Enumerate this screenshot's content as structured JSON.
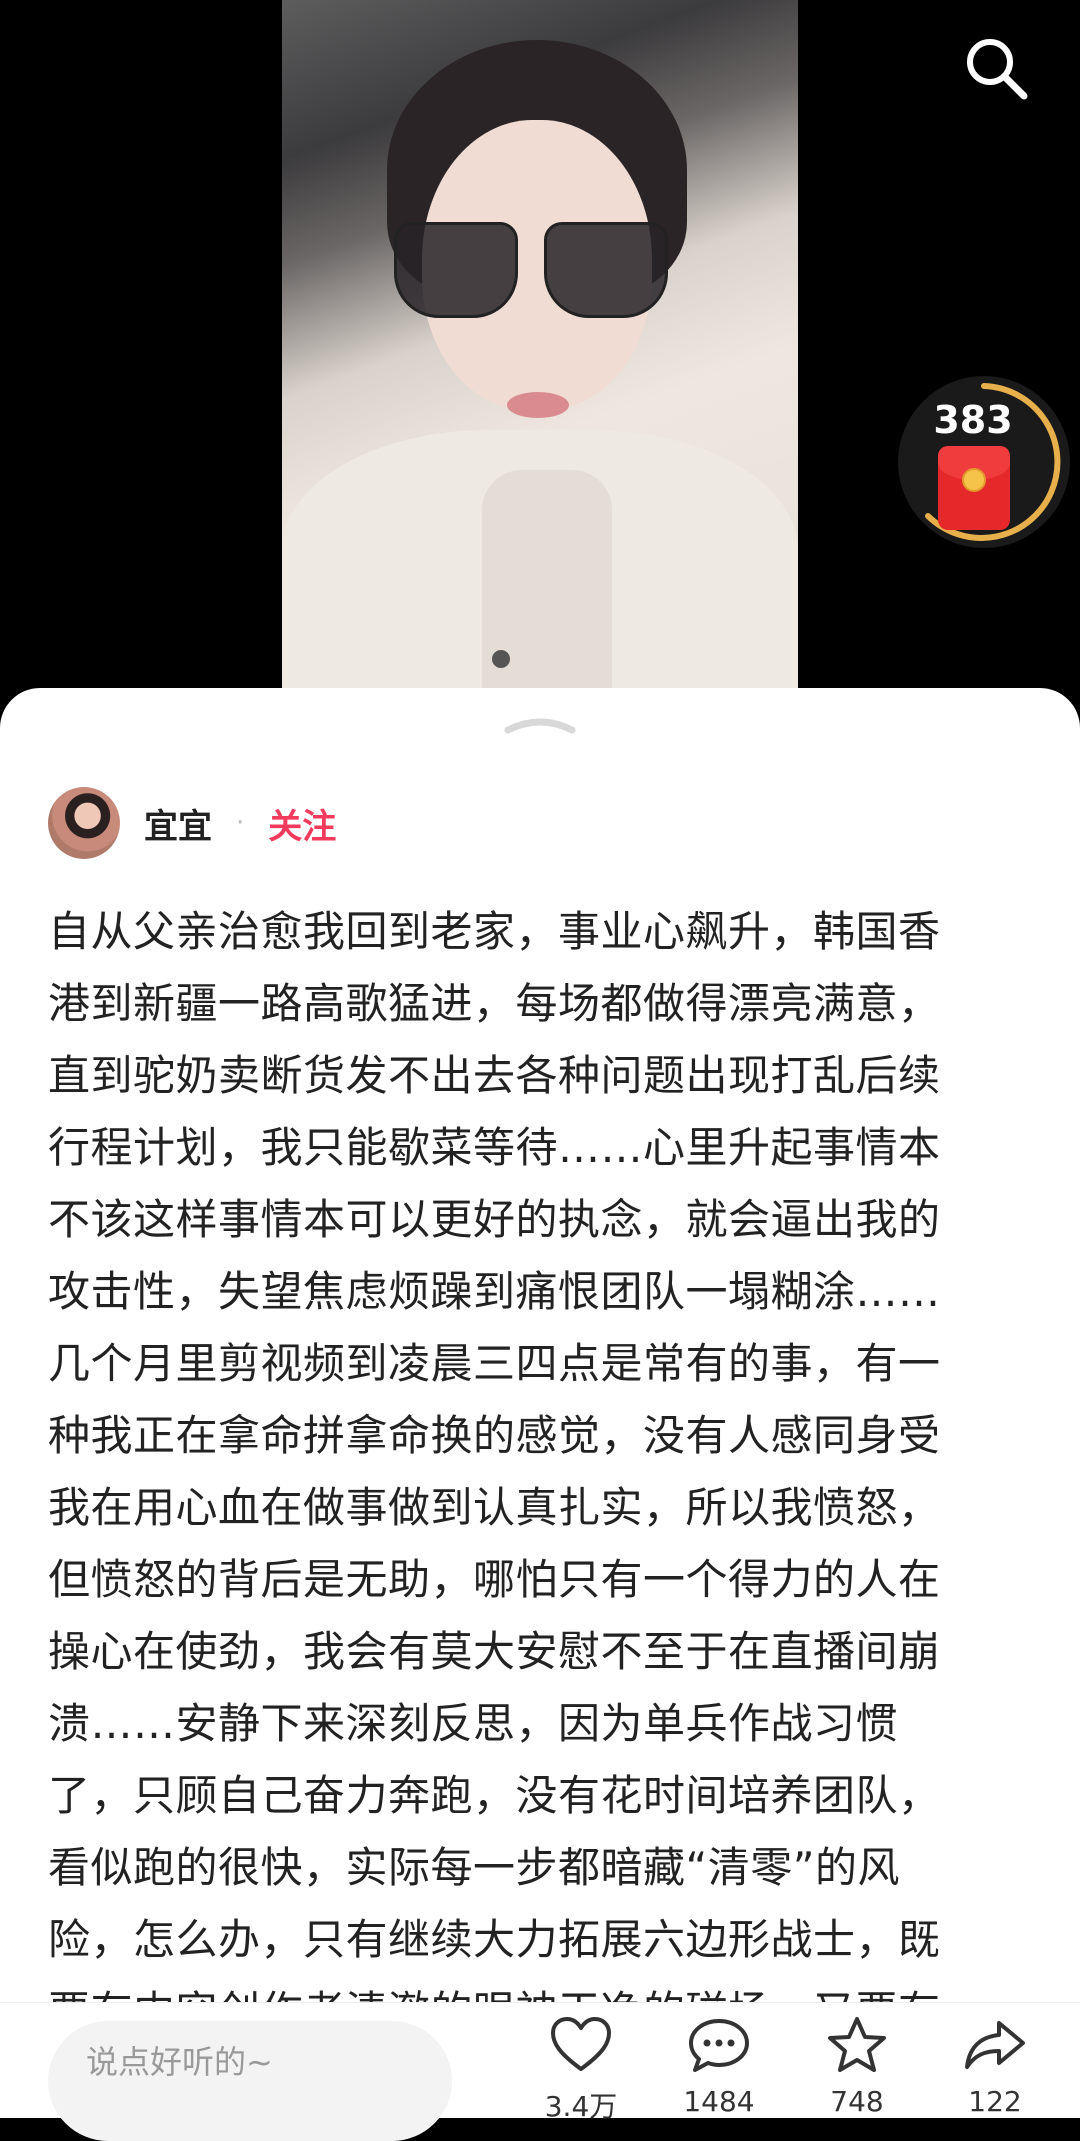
{
  "media": {
    "red_packet_count": "383"
  },
  "author": {
    "name": "宜宜",
    "separator": "·",
    "follow_label": "关注"
  },
  "post": {
    "lines": [
      "自从父亲治愈我回到老家，事业心飙升，韩国香",
      "港到新疆一路高歌猛进，每场都做得漂亮满意，",
      "直到驼奶卖断货发不出去各种问题出现打乱后续",
      "行程计划，我只能歇菜等待……心里升起事情本",
      "不该这样事情本可以更好的执念，就会逼出我的",
      "攻击性，失望焦虑烦躁到痛恨团队一塌糊涂……",
      "几个月里剪视频到凌晨三四点是常有的事，有一",
      "种我正在拿命拼拿命换的感觉，没有人感同身受",
      "我在用心血在做事做到认真扎实，所以我愤怒，",
      "但愤怒的背后是无助，哪怕只有一个得力的人在",
      "操心在使劲，我会有莫大安慰不至于在直播间崩",
      "溃……安静下来深刻反思，因为单兵作战习惯",
      "了，只顾自己奋力奔跑，没有花时间培养团队，",
      "看似跑的很快，实际每一步都暗藏“清零”的风",
      "险，怎么办，只有继续大力拓展六边形战士，既",
      "要有内容创作者清澈的眼神干净的磁场，又要有"
    ]
  },
  "bottom_bar": {
    "comment_placeholder": "说点好听的~",
    "like_count": "3.4万",
    "comment_count": "1484",
    "star_count": "748",
    "share_count": "122"
  },
  "icons": {
    "search": "search-icon",
    "like": "heart-icon",
    "comment": "comment-bubble-icon",
    "star": "star-icon",
    "share": "share-arrow-icon",
    "red_packet": "red-envelope-icon"
  },
  "colors": {
    "follow": "#f23a5c",
    "red_packet": "#e5282a",
    "progress_ring": "#e8b04a"
  }
}
